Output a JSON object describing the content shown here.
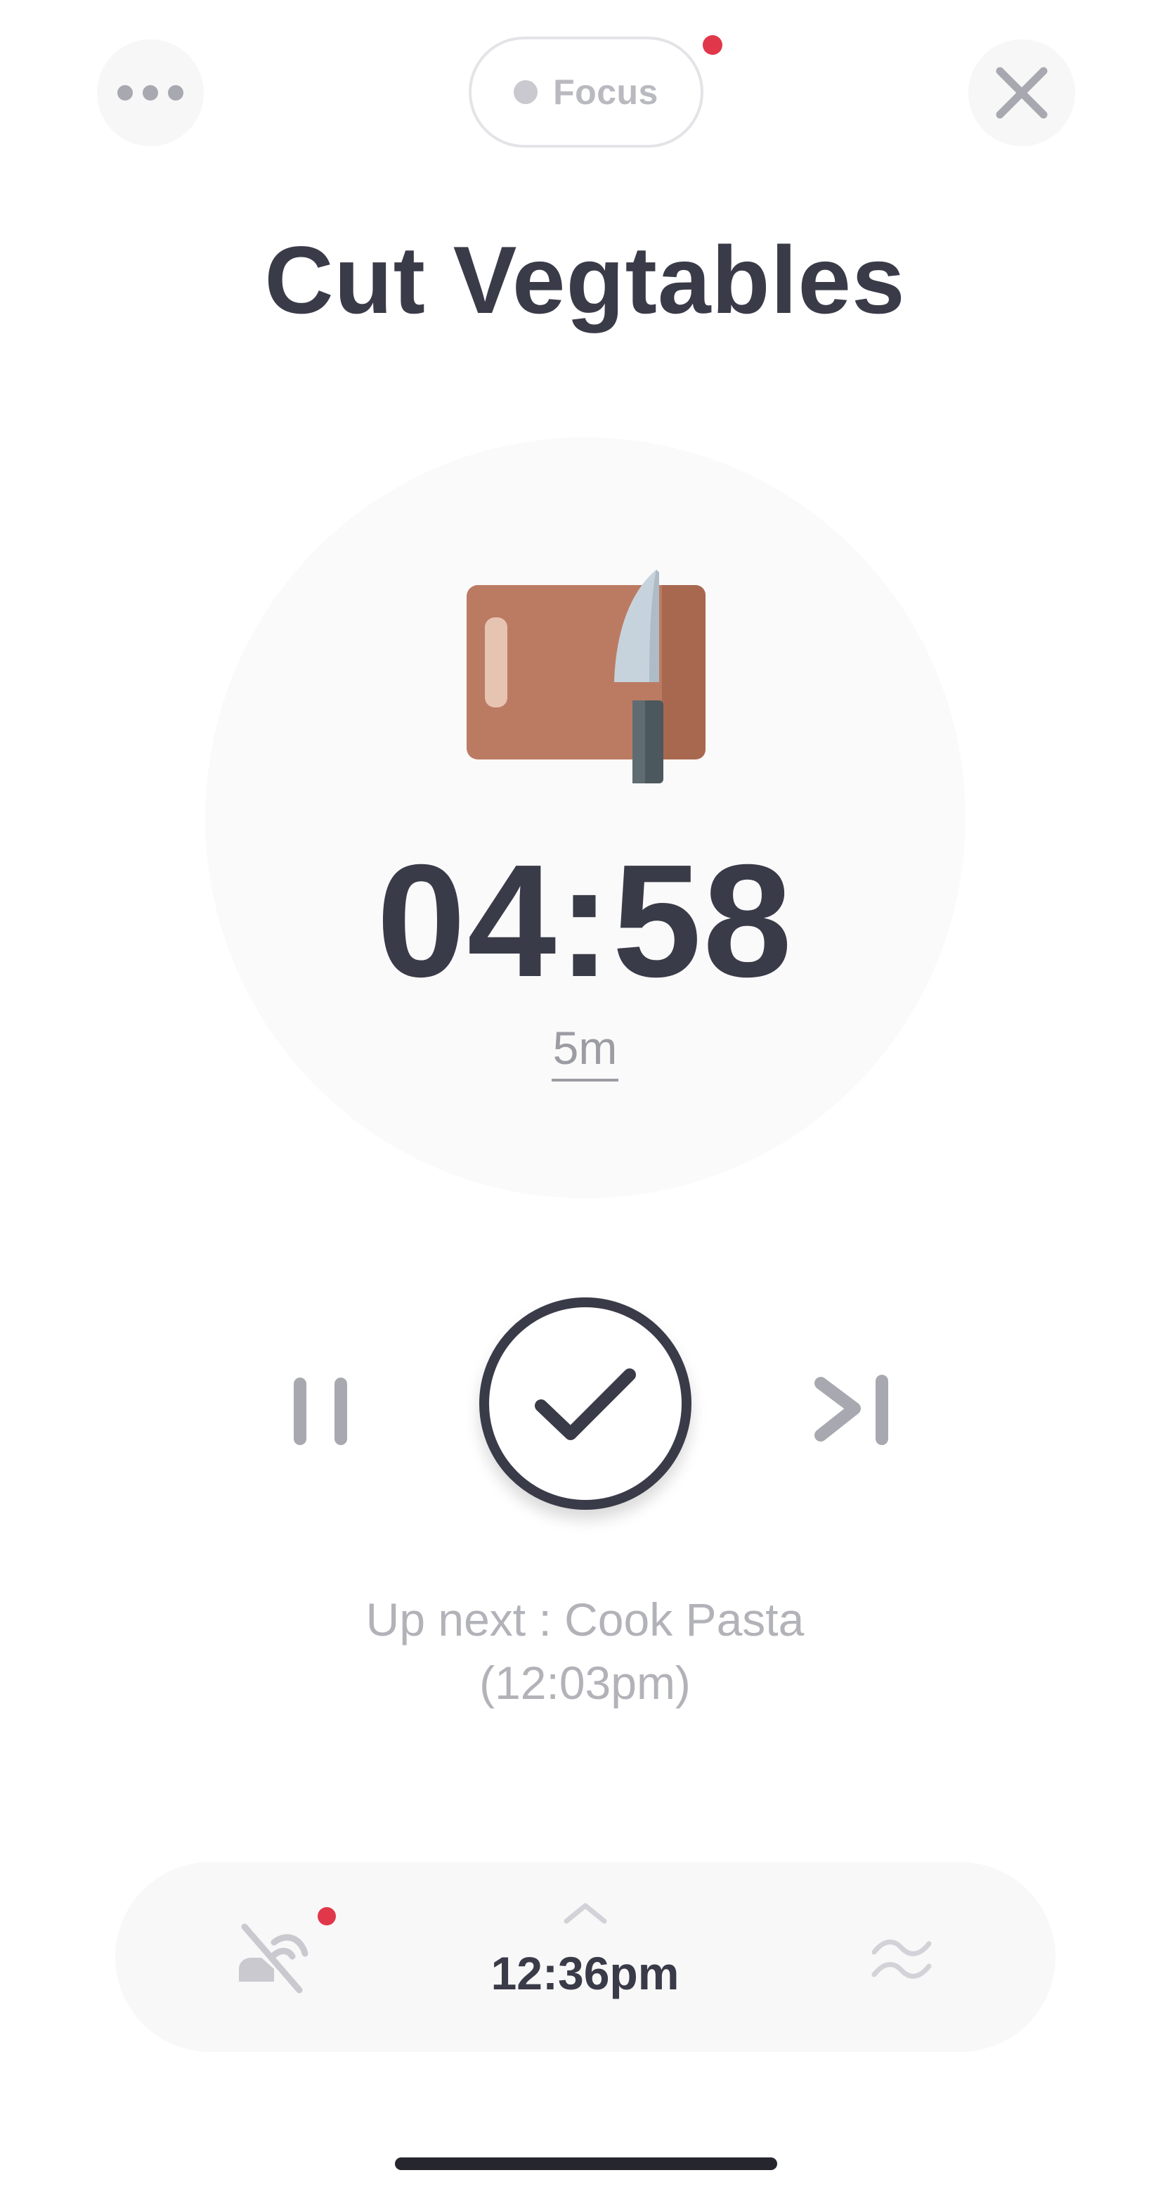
{
  "header": {
    "focus_label": "Focus"
  },
  "task": {
    "title": "Cut Vegtables",
    "icon": "cutting-board-knife-icon"
  },
  "timer": {
    "remaining": "04:58",
    "duration": "5m"
  },
  "up_next": {
    "line1": "Up next : Cook Pasta",
    "line2": "(12:03pm)"
  },
  "bottom_bar": {
    "current_time": "12:36pm"
  },
  "colors": {
    "text_dark": "#3a3b48",
    "text_muted": "#b2b2b9",
    "notification": "#e0384a",
    "board": "#bb7b63",
    "board_edge": "#a8684f"
  }
}
